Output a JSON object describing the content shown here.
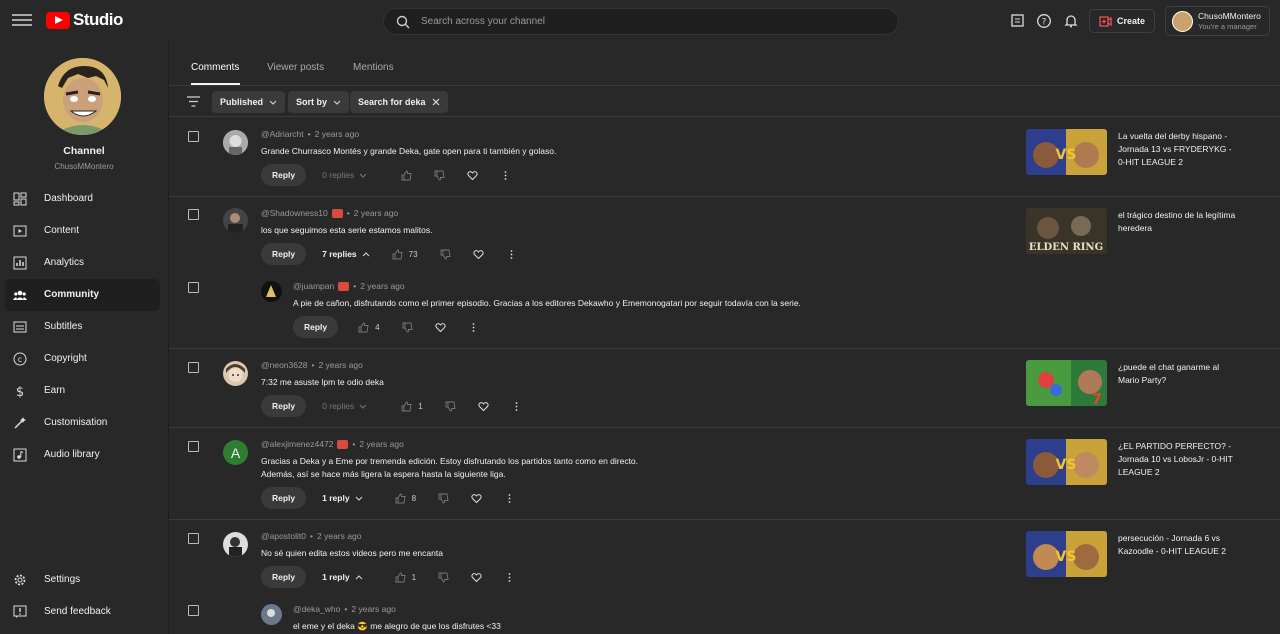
{
  "app": {
    "name": "Studio"
  },
  "search": {
    "placeholder": "Search across your channel"
  },
  "header": {
    "create_label": "Create",
    "account_name": "ChusoMMontero",
    "account_role": "You're a manager"
  },
  "sidebar": {
    "channel_label": "Channel",
    "channel_handle": "ChusoMMontero",
    "items": [
      {
        "label": "Dashboard",
        "icon": "dashboard-icon"
      },
      {
        "label": "Content",
        "icon": "content-icon"
      },
      {
        "label": "Analytics",
        "icon": "analytics-icon"
      },
      {
        "label": "Community",
        "icon": "community-icon",
        "active": true
      },
      {
        "label": "Subtitles",
        "icon": "subtitles-icon"
      },
      {
        "label": "Copyright",
        "icon": "copyright-icon"
      },
      {
        "label": "Earn",
        "icon": "earn-icon"
      },
      {
        "label": "Customisation",
        "icon": "customisation-icon"
      },
      {
        "label": "Audio library",
        "icon": "audio-library-icon"
      }
    ],
    "bottom": [
      {
        "label": "Settings",
        "icon": "gear-icon"
      },
      {
        "label": "Send feedback",
        "icon": "feedback-icon"
      }
    ]
  },
  "tabs": [
    {
      "label": "Comments",
      "active": true
    },
    {
      "label": "Viewer posts"
    },
    {
      "label": "Mentions"
    }
  ],
  "filters": {
    "published": "Published",
    "sort": "Sort by",
    "search_chip": "Search for deka"
  },
  "comments": [
    {
      "author": "@Adriarcht",
      "time": "2 years ago",
      "text": "Grande Churrasco Montés y grande Deka, gate open para ti también y golaso.",
      "reply": "Reply",
      "replies": "0 replies",
      "likes": "",
      "video_title": "La vuelta del derby hispano - Jornada 13 vs FRYDERYKG - 0-HIT LEAGUE 2"
    },
    {
      "author": "@Shadowness10",
      "time": "2 years ago",
      "text": "los que seguimos esta serie estamos malitos.",
      "reply": "Reply",
      "replies": "7 replies",
      "likes": "73",
      "video_title": "el trágico destino de la legítima heredera"
    },
    {
      "author": "@juampan",
      "time": "2 years ago",
      "text": "A pie de cañon, disfrutando como el primer episodio. Gracias a los editores Dekawho y Ememonogatari por seguir todavía con la serie.",
      "reply": "Reply",
      "likes": "4"
    },
    {
      "author": "@neon3628",
      "time": "2 years ago",
      "text": "7:32 me asuste lpm te odio deka",
      "reply": "Reply",
      "replies": "0 replies",
      "likes": "1",
      "video_title": "¿puede el chat ganarme al Mario Party?"
    },
    {
      "author": "@alexjimenez4472",
      "time": "2 years ago",
      "text": "Gracias a Deka y a Eme por tremenda edición. Estoy disfrutando los partidos tanto como en directo.",
      "text2": "Además, así se hace más ligera la espera hasta la siguiente liga.",
      "reply": "Reply",
      "replies": "1 reply",
      "likes": "8",
      "avatar_letter": "A",
      "video_title": "¿EL PARTIDO PERFECTO? - Jornada 10 vs LobosJr - 0-HIT LEAGUE 2"
    },
    {
      "author": "@apostolit0",
      "time": "2 years ago",
      "text": "No sé quien edita estos videos pero me encanta",
      "reply": "Reply",
      "replies": "1 reply",
      "likes": "1",
      "video_title": "persecución - Jornada 6 vs Kazoodle - 0-HIT LEAGUE 2"
    },
    {
      "author": "@deka_who",
      "time": "2 years ago",
      "text": "el eme y el deka 😎 me alegro de que los disfrutes <33"
    }
  ]
}
